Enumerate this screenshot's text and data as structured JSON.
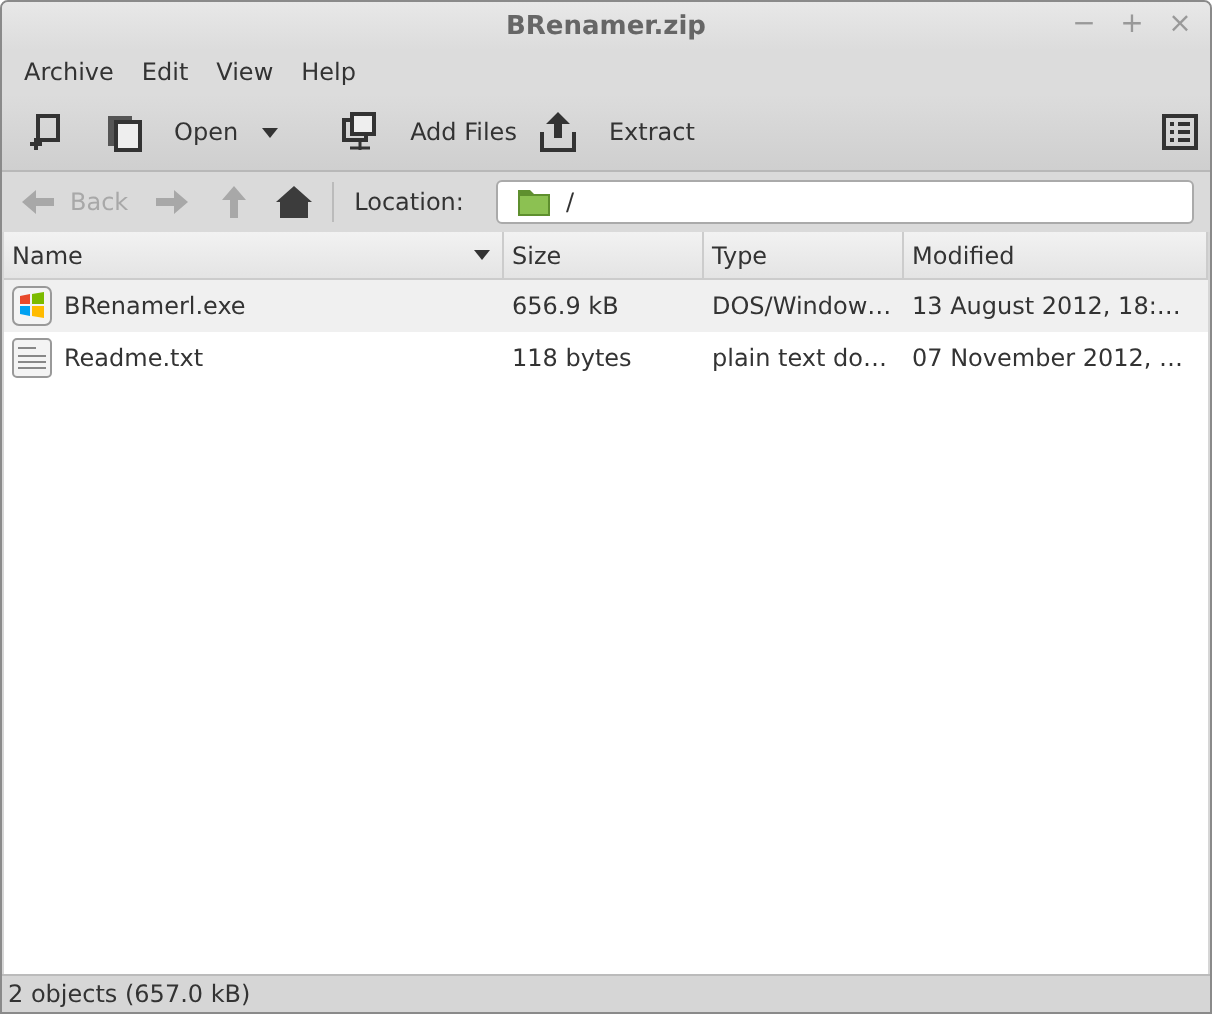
{
  "window": {
    "title": "BRenamer.zip",
    "controls": [
      "−",
      "+",
      "×"
    ]
  },
  "menu": [
    "Archive",
    "Edit",
    "View",
    "Help"
  ],
  "toolbar": {
    "open": "Open",
    "add": "Add Files",
    "extract": "Extract"
  },
  "nav": {
    "back": {
      "label": "Back",
      "disabled": true
    },
    "forward": {
      "disabled": true
    },
    "up": {
      "disabled": true
    },
    "home": {
      "disabled": false
    },
    "location_label": "Location:",
    "location": "/"
  },
  "table": {
    "columns": [
      "Name",
      "Size",
      "Type",
      "Modified"
    ],
    "rows": [
      {
        "kind": "exe",
        "name": "BRenamerl.exe",
        "size": "656.9 kB",
        "type": "DOS/Window…",
        "modified": "13 August 2012, 18:…"
      },
      {
        "kind": "text",
        "name": "Readme.txt",
        "size": "118 bytes",
        "type": "plain text do…",
        "modified": "07 November 2012, …"
      }
    ]
  },
  "status_bar": "2 objects (657.0 kB)"
}
